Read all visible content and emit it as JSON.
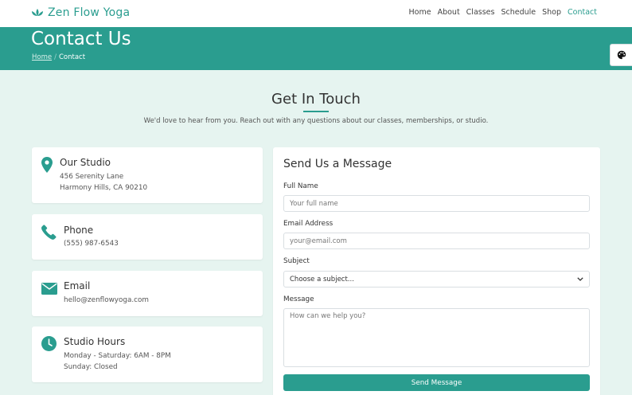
{
  "brand": {
    "name": "Zen Flow Yoga",
    "color": "#2a9d8f",
    "icon": "lotus-icon"
  },
  "nav": [
    {
      "label": "Home",
      "active": false
    },
    {
      "label": "About",
      "active": false
    },
    {
      "label": "Classes",
      "active": false
    },
    {
      "label": "Schedule",
      "active": false
    },
    {
      "label": "Shop",
      "active": false
    },
    {
      "label": "Contact",
      "active": true
    }
  ],
  "hero": {
    "title": "Contact Us",
    "breadcrumb": {
      "home": "Home",
      "current": "Contact"
    }
  },
  "intro": {
    "title": "Get In Touch",
    "subtitle": "We'd love to hear from you. Reach out with any questions about our classes, memberships, or studio."
  },
  "info_cards": {
    "studio": {
      "icon": "map-pin-icon",
      "title": "Our Studio",
      "line1": "456 Serenity Lane",
      "line2": "Harmony Hills, CA 90210"
    },
    "phone": {
      "icon": "phone-icon",
      "title": "Phone",
      "line1": "(555) 987-6543"
    },
    "email": {
      "icon": "envelope-icon",
      "title": "Email",
      "line1": "hello@zenflowyoga.com"
    },
    "hours": {
      "icon": "clock-icon",
      "title": "Studio Hours",
      "line1": "Monday - Saturday: 6AM - 8PM",
      "line2": "Sunday: Closed"
    }
  },
  "form": {
    "title": "Send Us a Message",
    "name": {
      "label": "Full Name",
      "placeholder": "Your full name"
    },
    "email": {
      "label": "Email Address",
      "placeholder": "your@email.com"
    },
    "subject": {
      "label": "Subject",
      "selected": "Choose a subject..."
    },
    "message": {
      "label": "Message",
      "placeholder": "How can we help you?"
    },
    "submit_label": "Send Message"
  },
  "colors": {
    "accent": "#2a9d8f",
    "page_bg": "#e6f4f0"
  },
  "theme_button": {
    "icon": "palette-icon"
  }
}
